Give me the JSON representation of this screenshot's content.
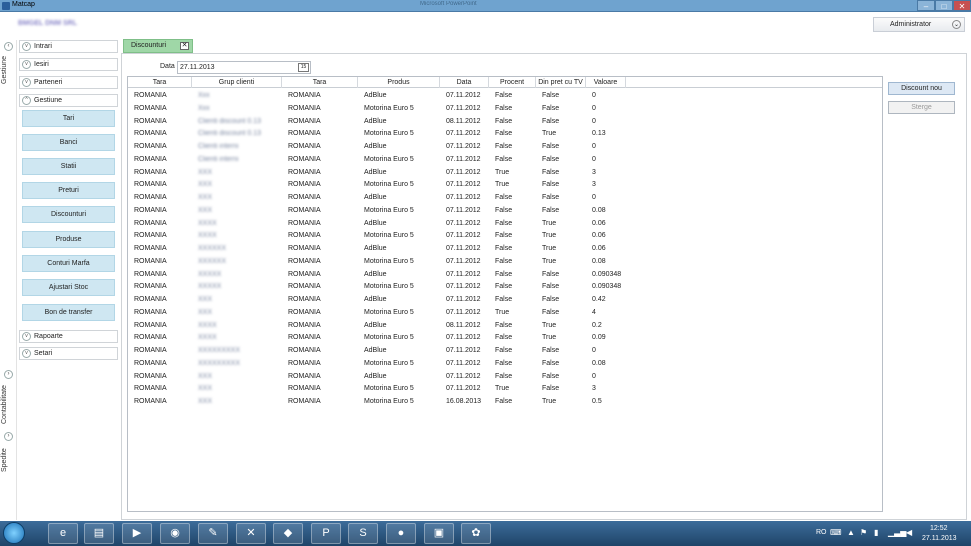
{
  "window": {
    "title": "Matcap",
    "center_title": "Microsoft PowerPoint",
    "min": "–",
    "max": "□",
    "close": "✕"
  },
  "app": {
    "company": "BMGEL DNM SRL",
    "user": "Administrator"
  },
  "left_strip": {
    "gestiune": "Gestiune",
    "contabilitate": "Contabilitate",
    "spedite": "Spedite"
  },
  "nav": {
    "groups": {
      "intrari": "Intrari",
      "iesiri": "Iesiri",
      "parteneri": "Parteneri",
      "gestiune": "Gestiune",
      "rapoarte": "Rapoarte",
      "setari": "Setari"
    },
    "items": [
      "Tari",
      "Banci",
      "Statii",
      "Preturi",
      "Discounturi",
      "Produse",
      "Conturi Marfa",
      "Ajustari Stoc",
      "Bon de transfer"
    ]
  },
  "tab": {
    "label": "Discounturi",
    "close": "✕"
  },
  "filter": {
    "label": "Data",
    "value": "27.11.2013",
    "cal_icon": "15"
  },
  "columns": [
    "Tara",
    "Grup clienti",
    "Tara",
    "Produs",
    "Data",
    "Procent",
    "Din pret cu TV",
    "Valoare"
  ],
  "rows": [
    [
      "ROMANIA",
      "Xxx",
      "ROMANIA",
      "AdBlue",
      "07.11.2012",
      "False",
      "False",
      "0"
    ],
    [
      "ROMANIA",
      "Xxx",
      "ROMANIA",
      "Motorina Euro 5",
      "07.11.2012",
      "False",
      "False",
      "0"
    ],
    [
      "ROMANIA",
      "Clienti discount 0.13",
      "ROMANIA",
      "AdBlue",
      "08.11.2012",
      "False",
      "False",
      "0"
    ],
    [
      "ROMANIA",
      "Clienti discount 0.13",
      "ROMANIA",
      "Motorina Euro 5",
      "07.11.2012",
      "False",
      "True",
      "0.13"
    ],
    [
      "ROMANIA",
      "Clienti interni",
      "ROMANIA",
      "AdBlue",
      "07.11.2012",
      "False",
      "False",
      "0"
    ],
    [
      "ROMANIA",
      "Clienti interni",
      "ROMANIA",
      "Motorina Euro 5",
      "07.11.2012",
      "False",
      "False",
      "0"
    ],
    [
      "ROMANIA",
      "XXX",
      "ROMANIA",
      "AdBlue",
      "07.11.2012",
      "True",
      "False",
      "3"
    ],
    [
      "ROMANIA",
      "XXX",
      "ROMANIA",
      "Motorina Euro 5",
      "07.11.2012",
      "True",
      "False",
      "3"
    ],
    [
      "ROMANIA",
      "XXX",
      "ROMANIA",
      "AdBlue",
      "07.11.2012",
      "False",
      "False",
      "0"
    ],
    [
      "ROMANIA",
      "XXX",
      "ROMANIA",
      "Motorina Euro 5",
      "07.11.2012",
      "False",
      "False",
      "0.08"
    ],
    [
      "ROMANIA",
      "XXXX",
      "ROMANIA",
      "AdBlue",
      "07.11.2012",
      "False",
      "True",
      "0.06"
    ],
    [
      "ROMANIA",
      "XXXX",
      "ROMANIA",
      "Motorina Euro 5",
      "07.11.2012",
      "False",
      "True",
      "0.06"
    ],
    [
      "ROMANIA",
      "XXXXXX",
      "ROMANIA",
      "AdBlue",
      "07.11.2012",
      "False",
      "True",
      "0.06"
    ],
    [
      "ROMANIA",
      "XXXXXX",
      "ROMANIA",
      "Motorina Euro 5",
      "07.11.2012",
      "False",
      "True",
      "0.08"
    ],
    [
      "ROMANIA",
      "XXXXX",
      "ROMANIA",
      "AdBlue",
      "07.11.2012",
      "False",
      "False",
      "0.090348"
    ],
    [
      "ROMANIA",
      "XXXXX",
      "ROMANIA",
      "Motorina Euro 5",
      "07.11.2012",
      "False",
      "False",
      "0.090348"
    ],
    [
      "ROMANIA",
      "XXX",
      "ROMANIA",
      "AdBlue",
      "07.11.2012",
      "False",
      "False",
      "0.42"
    ],
    [
      "ROMANIA",
      "XXX",
      "ROMANIA",
      "Motorina Euro 5",
      "07.11.2012",
      "True",
      "False",
      "4"
    ],
    [
      "ROMANIA",
      "XXXX",
      "ROMANIA",
      "AdBlue",
      "08.11.2012",
      "False",
      "True",
      "0.2"
    ],
    [
      "ROMANIA",
      "XXXX",
      "ROMANIA",
      "Motorina Euro 5",
      "07.11.2012",
      "False",
      "True",
      "0.09"
    ],
    [
      "ROMANIA",
      "XXXXXXXXX",
      "ROMANIA",
      "AdBlue",
      "07.11.2012",
      "False",
      "False",
      "0"
    ],
    [
      "ROMANIA",
      "XXXXXXXXX",
      "ROMANIA",
      "Motorina Euro 5",
      "07.11.2012",
      "False",
      "False",
      "0.08"
    ],
    [
      "ROMANIA",
      "XXX",
      "ROMANIA",
      "AdBlue",
      "07.11.2012",
      "False",
      "False",
      "0"
    ],
    [
      "ROMANIA",
      "XXX",
      "ROMANIA",
      "Motorina Euro 5",
      "07.11.2012",
      "True",
      "False",
      "3"
    ],
    [
      "ROMANIA",
      "XXX",
      "ROMANIA",
      "Motorina Euro 5",
      "16.08.2013",
      "False",
      "True",
      "0.5"
    ]
  ],
  "actions": {
    "new": "Discount nou",
    "delete": "Sterge"
  },
  "tray": {
    "lang": "RO",
    "time": "12:52",
    "date": "27.11.2013"
  }
}
